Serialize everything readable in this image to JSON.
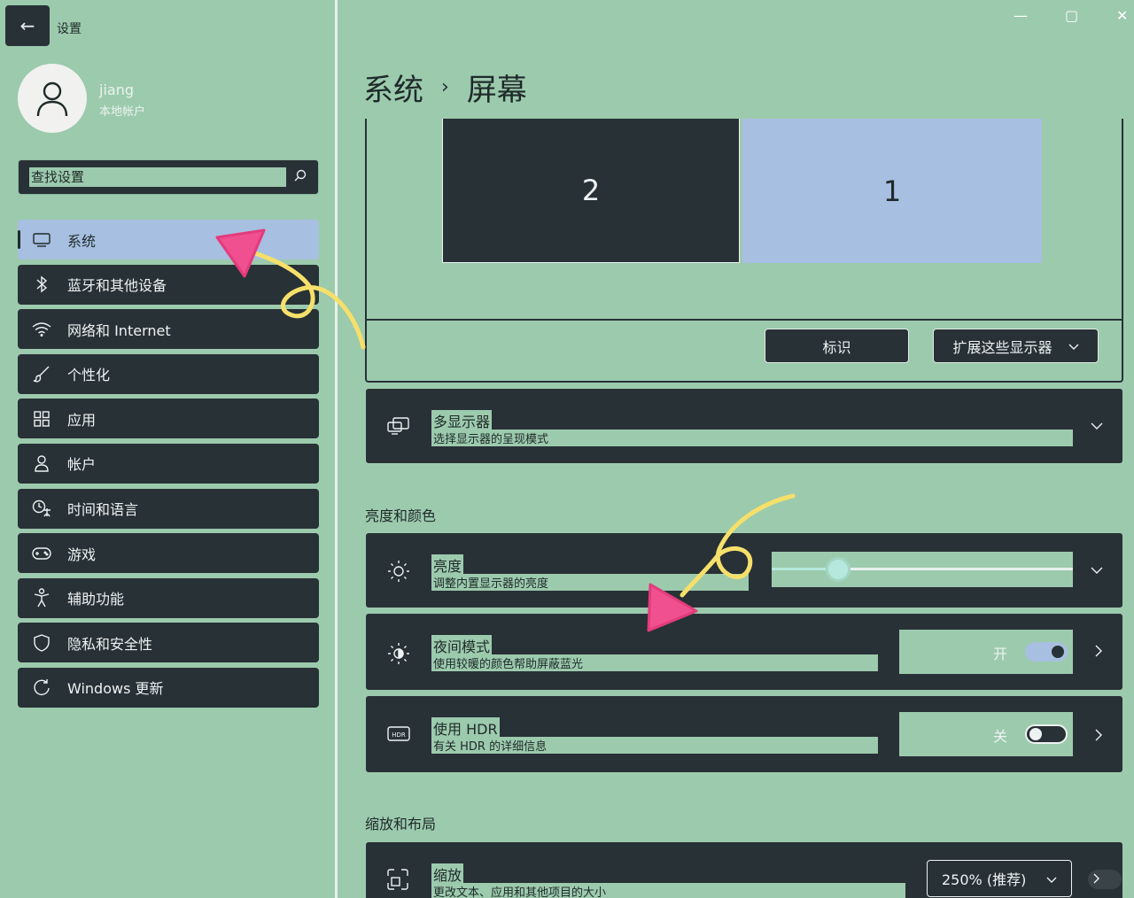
{
  "window": {
    "title": "设置",
    "back_icon": "←",
    "minimize_icon": "—",
    "maximize_icon": "▢",
    "close_icon": "✕"
  },
  "profile": {
    "name": "jiang",
    "account_type": "本地帐户"
  },
  "search": {
    "placeholder": "查找设置",
    "value": ""
  },
  "sidebar": {
    "items": [
      {
        "label": "系统",
        "icon": "monitor-icon",
        "active": true
      },
      {
        "label": "蓝牙和其他设备",
        "icon": "bluetooth-icon"
      },
      {
        "label": "网络和 Internet",
        "icon": "wifi-icon"
      },
      {
        "label": "个性化",
        "icon": "brush-icon"
      },
      {
        "label": "应用",
        "icon": "apps-icon"
      },
      {
        "label": "帐户",
        "icon": "person-icon"
      },
      {
        "label": "时间和语言",
        "icon": "clock-globe-icon"
      },
      {
        "label": "游戏",
        "icon": "gamepad-icon"
      },
      {
        "label": "辅助功能",
        "icon": "accessibility-icon"
      },
      {
        "label": "隐私和安全性",
        "icon": "shield-icon"
      },
      {
        "label": "Windows 更新",
        "icon": "update-icon"
      }
    ]
  },
  "breadcrumb": {
    "parent": "系统",
    "separator": "›",
    "current": "屏幕"
  },
  "arrangement": {
    "monitors": [
      {
        "label": "2",
        "selected": false
      },
      {
        "label": "1",
        "selected": true
      }
    ],
    "identify_label": "标识",
    "extend_label": "扩展这些显示器"
  },
  "multi_display": {
    "title": "多显示器",
    "subtitle": "选择显示器的呈现模式"
  },
  "brightness_section": "亮度和颜色",
  "brightness": {
    "title": "亮度",
    "subtitle": "调整内置显示器的亮度",
    "level": 0.22
  },
  "night_light": {
    "title": "夜间模式",
    "subtitle": "使用较暖的颜色帮助屏蔽蓝光",
    "state_label": "开",
    "on": true
  },
  "hdr": {
    "title": "使用 HDR",
    "subtitle": "有关 HDR 的详细信息",
    "state_label": "关",
    "on": false
  },
  "scale_section": "缩放和布局",
  "scale": {
    "title": "缩放",
    "subtitle": "更改文本、应用和其他项目的大小",
    "value": "250% (推荐)"
  },
  "colors": {
    "background": "#9ccaad",
    "card": "#283136",
    "accent": "#a7bfe0",
    "annotation_pink": "#f0508f",
    "annotation_yellow": "#f6e06a"
  }
}
